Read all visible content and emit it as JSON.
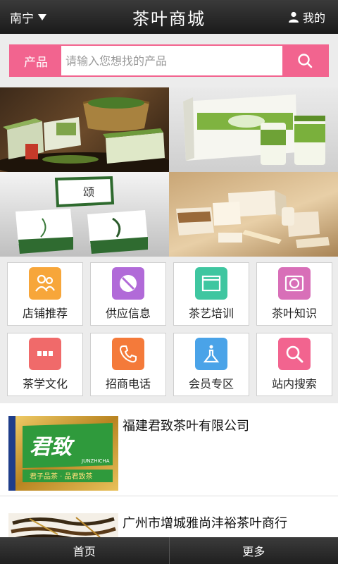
{
  "header": {
    "city": "南宁",
    "title": "茶叶商城",
    "user_label": "我的"
  },
  "search": {
    "category": "产品",
    "placeholder": "请输入您想找的产品"
  },
  "banner": [
    {
      "icon": "tea-products-photo"
    },
    {
      "icon": "tea-gift-box-photo"
    },
    {
      "icon": "tea-tin-boxes-photo"
    },
    {
      "icon": "tea-packaging-set-photo"
    }
  ],
  "menu": [
    {
      "label": "店铺推荐",
      "icon": "users-icon",
      "color": "#f7a63a"
    },
    {
      "label": "供应信息",
      "icon": "circle-slash-icon",
      "color": "#b16ad8"
    },
    {
      "label": "茶艺培训",
      "icon": "browser-window-icon",
      "color": "#3fc6a0"
    },
    {
      "label": "茶叶知识",
      "icon": "book-icon",
      "color": "#d86fb8"
    },
    {
      "label": "茶学文化",
      "icon": "dots-icon",
      "color": "#f06a6a"
    },
    {
      "label": "招商电话",
      "icon": "phone-icon",
      "color": "#f47a3a"
    },
    {
      "label": "会员专区",
      "icon": "info-flask-icon",
      "color": "#4aa3e8"
    },
    {
      "label": "站内搜索",
      "icon": "search-icon",
      "color": "#f2648f"
    }
  ],
  "list": [
    {
      "title": "福建君致茶叶有限公司",
      "logo_text": "君致",
      "logo_sub": "JUNZHICHA",
      "slogan": "君子品茶 · 品君致茶"
    },
    {
      "title": "广州市增城雅尚沣裕茶叶商行"
    }
  ],
  "bottom": {
    "home": "首页",
    "more": "更多"
  }
}
